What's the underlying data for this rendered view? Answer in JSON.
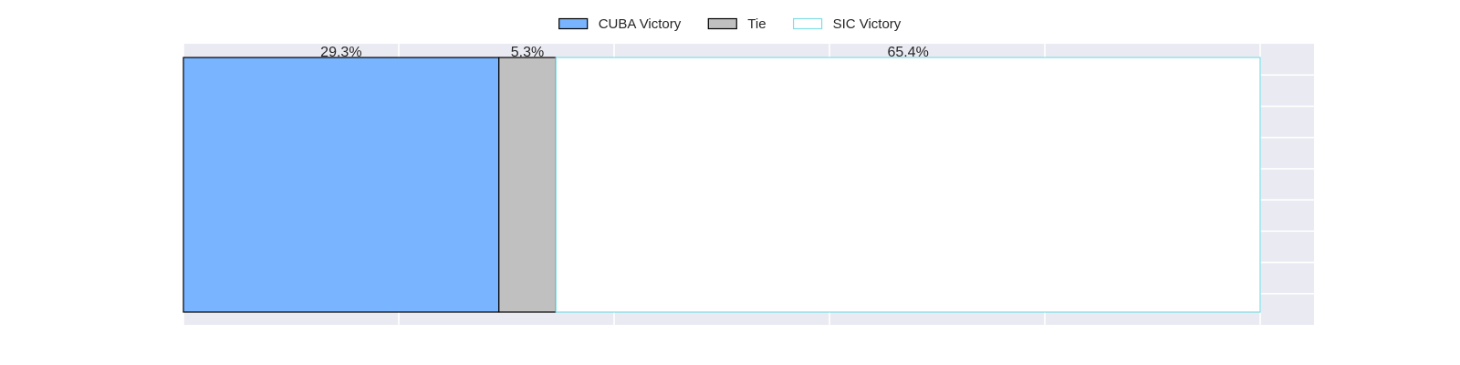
{
  "chart_data": {
    "type": "bar",
    "orientation": "horizontal",
    "stacked": true,
    "categories": [
      ""
    ],
    "series": [
      {
        "name": "CUBA Victory",
        "values": [
          29.3
        ],
        "label": "29.3%",
        "fill": "#78b4ff",
        "stroke": "#000000"
      },
      {
        "name": "Tie",
        "values": [
          5.3
        ],
        "label": "5.3%",
        "fill": "#c0c0c0",
        "stroke": "#000000"
      },
      {
        "name": "SIC Victory",
        "values": [
          65.4
        ],
        "label": "65.4%",
        "fill": "#ffffff",
        "stroke": "#7fdde6"
      }
    ],
    "xlim": [
      0,
      105
    ],
    "x_gridlines": [
      0,
      20,
      40,
      60,
      80,
      100
    ],
    "y_gridlines": 9,
    "legend_position": "top-center",
    "grid": true,
    "axis_ticks_visible": false
  },
  "colors": {
    "plot_background": "#eaeaf2",
    "grid": "#ffffff",
    "text": "#262626"
  }
}
